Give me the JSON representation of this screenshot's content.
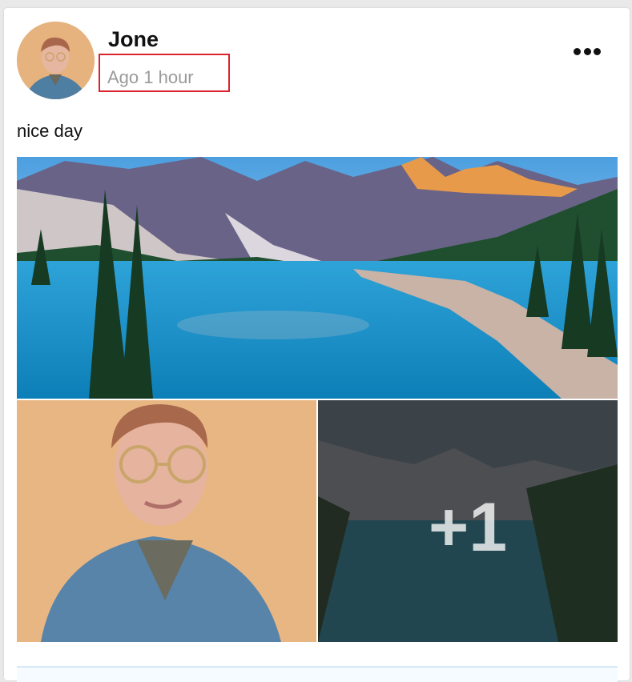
{
  "post": {
    "author": "Jone",
    "time": "Ago 1 hour",
    "text": "nice day",
    "more_count": "+1"
  }
}
